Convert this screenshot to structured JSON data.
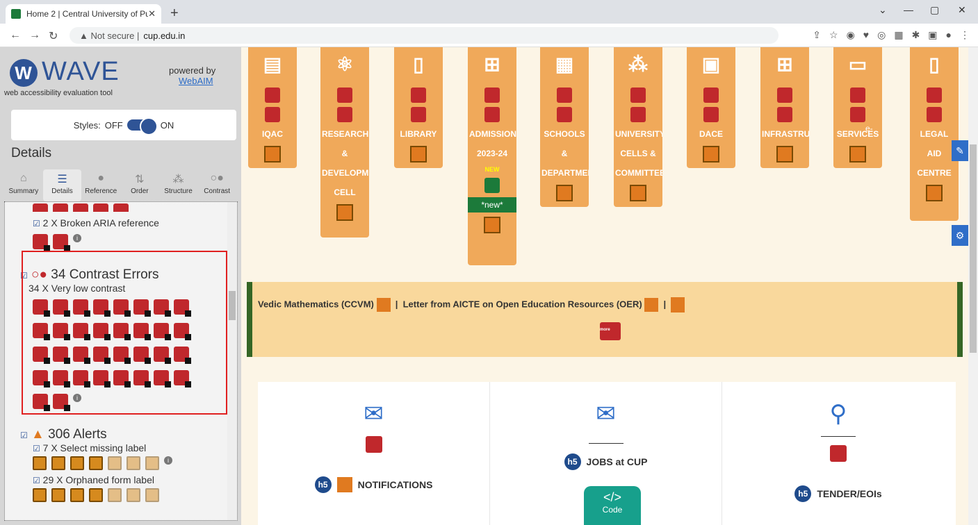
{
  "browser": {
    "tab_title": "Home 2 | Central University of Pu",
    "not_secure": "Not secure",
    "url": "cup.edu.in"
  },
  "wave": {
    "logo": "WAVE",
    "subtitle": "web accessibility evaluation tool",
    "powered_by": "powered by",
    "webaim": "WebAIM",
    "styles_label": "Styles:",
    "off": "OFF",
    "on": "ON",
    "details_heading": "Details",
    "tabs": [
      {
        "label": "Summary",
        "icon": "home-icon"
      },
      {
        "label": "Details",
        "icon": "list-icon"
      },
      {
        "label": "Reference",
        "icon": "info-icon"
      },
      {
        "label": "Order",
        "icon": "order-icon"
      },
      {
        "label": "Structure",
        "icon": "structure-icon"
      },
      {
        "label": "Contrast",
        "icon": "contrast-icon"
      }
    ],
    "aria_ref": "2 X Broken ARIA reference",
    "contrast_header": "34 Contrast Errors",
    "contrast_sub": "34 X Very low contrast",
    "alerts_header": "306 Alerts",
    "select_label": "7 X Select missing label",
    "orphaned_label": "29 X Orphaned form label"
  },
  "sections": [
    {
      "label1": "IQAC",
      "label2": "",
      "label3": "",
      "label4": ""
    },
    {
      "label1": "RESEARCH",
      "label2": "&",
      "label3": "DEVELOPMENT",
      "label4": "CELL"
    },
    {
      "label1": "LIBRARY",
      "label2": "",
      "label3": "",
      "label4": ""
    },
    {
      "label1": "ADMISSIONS",
      "label2": "2023-24",
      "label3": "NEW",
      "label4": "*new*"
    },
    {
      "label1": "SCHOOLS",
      "label2": "&",
      "label3": "DEPARTMENTS",
      "label4": ""
    },
    {
      "label1": "UNIVERSITY",
      "label2": "CELLS &",
      "label3": "COMMITTEES",
      "label4": ""
    },
    {
      "label1": "DACE",
      "label2": "",
      "label3": "",
      "label4": ""
    },
    {
      "label1": "INFRASTRUCTURE",
      "label2": "",
      "label3": "",
      "label4": ""
    },
    {
      "label1": "e-",
      "label2": "SERVICES",
      "label3": "",
      "label4": ""
    },
    {
      "label1": "LEGAL",
      "label2": "AID",
      "label3": "CENTRE",
      "label4": ""
    }
  ],
  "ticker": {
    "text1": "Vedic Mathematics (CCVM)",
    "sep": "|",
    "text2": "Letter from AICTE on Open Education Resources (OER)",
    "sep2": "|",
    "more": "more"
  },
  "cards": [
    {
      "title": "NOTIFICATIONS",
      "badge": "h5"
    },
    {
      "title": "JOBS at CUP",
      "badge": "h5"
    },
    {
      "title": "TENDER/EOIs",
      "badge": "h5"
    }
  ],
  "code": {
    "symbol": "</>",
    "label": "Code"
  }
}
